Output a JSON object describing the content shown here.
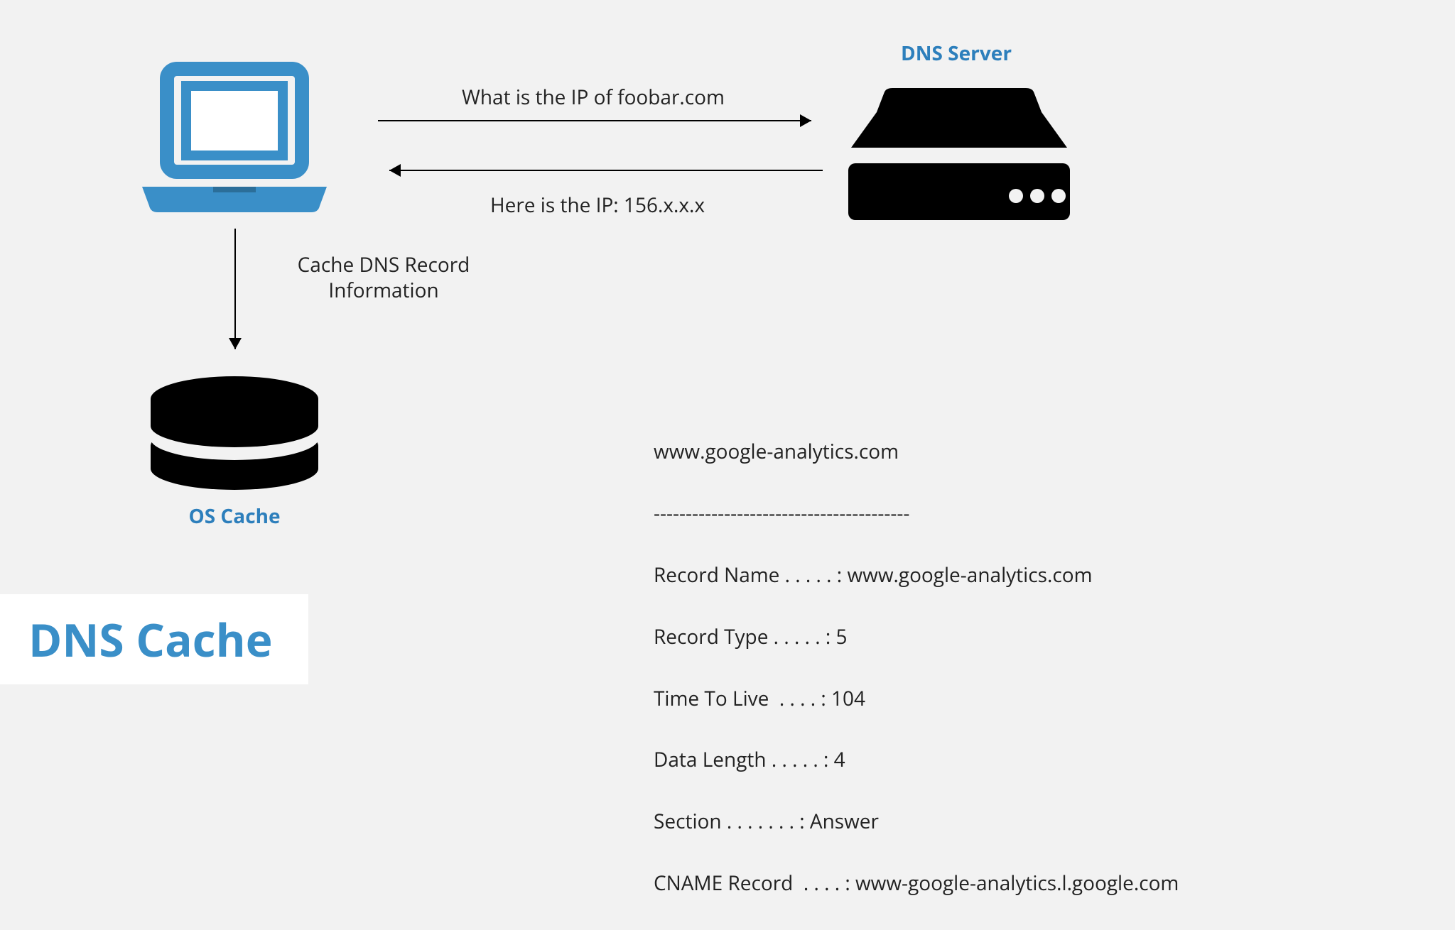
{
  "title": "DNS Cache",
  "server_label": "DNS Server",
  "os_label": "OS Cache",
  "query_label": "What is the IP of foobar.com",
  "response_label": "Here is the IP: 156.x.x.x",
  "cache_action_line1": "Cache DNS Record",
  "cache_action_line2": "Information",
  "record": {
    "host": "www.google-analytics.com",
    "divider": "----------------------------------------",
    "record_name": "Record Name . . . . . : www.google-analytics.com",
    "record_type": "Record Type . . . . . : 5",
    "ttl": "Time To Live  . . . . : 104",
    "data_length": "Data Length . . . . . : 4",
    "section": "Section . . . . . . . : Answer",
    "cname": "CNAME Record  . . . . : www-google-analytics.l.google.com"
  }
}
